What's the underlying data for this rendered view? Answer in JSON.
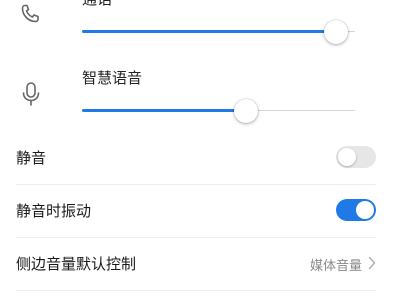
{
  "volumes": [
    {
      "label": "通话",
      "icon": "phone-icon",
      "level": 0.93
    },
    {
      "label": "智慧语音",
      "icon": "microphone-icon",
      "level": 0.6
    }
  ],
  "settings": {
    "mute": {
      "label": "静音",
      "enabled": false
    },
    "vibrate_on_mute": {
      "label": "静音时振动",
      "enabled": true
    },
    "side_volume_control": {
      "label": "侧边音量默认控制",
      "value": "媒体音量",
      "icon": "chevron-right-icon"
    }
  },
  "colors": {
    "accent": "#1f7ae8",
    "toggle_off": "#e6e6e6",
    "secondary_text": "#8a8a8a"
  }
}
